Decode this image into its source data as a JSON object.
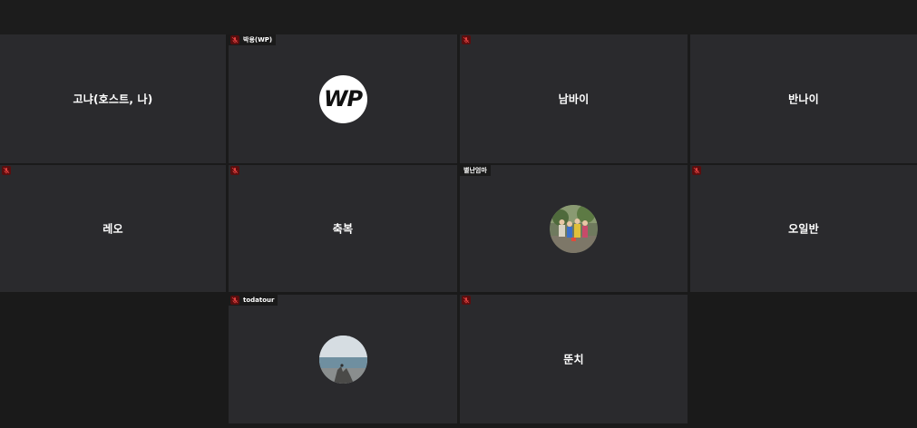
{
  "colors": {
    "background": "#1a1a1a",
    "tile_background": "#2a2a2d",
    "muted_mic": "#8b1a1a",
    "name_text": "#ffffff"
  },
  "participants": [
    {
      "name": "고냐(호스트, 나)",
      "label": "",
      "muted": true,
      "avatar": "none"
    },
    {
      "name": "",
      "label": "박용(WP)",
      "muted": true,
      "avatar": "wp-logo",
      "avatar_text": "WP"
    },
    {
      "name": "남바이",
      "label": "",
      "muted": true,
      "avatar": "none"
    },
    {
      "name": "반나이",
      "label": "",
      "muted": false,
      "avatar": "none"
    },
    {
      "name": "레오",
      "label": "",
      "muted": true,
      "avatar": "none"
    },
    {
      "name": "축복",
      "label": "",
      "muted": true,
      "avatar": "none"
    },
    {
      "name": "",
      "label": "별난엄마",
      "muted": false,
      "avatar": "photo-children"
    },
    {
      "name": "오일반",
      "label": "",
      "muted": true,
      "avatar": "none"
    },
    {
      "name": "",
      "label": "todatour",
      "muted": true,
      "avatar": "photo-seaside"
    },
    {
      "name": "뚠치",
      "label": "",
      "muted": true,
      "avatar": "none"
    }
  ]
}
